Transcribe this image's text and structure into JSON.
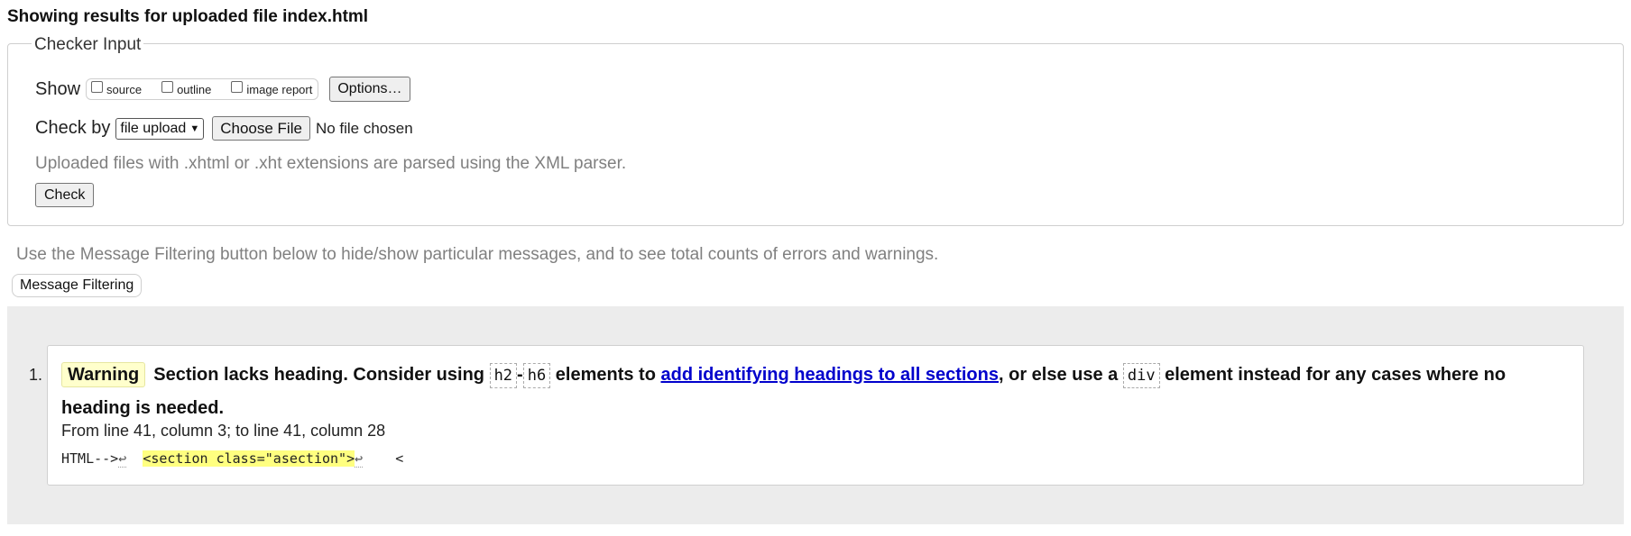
{
  "page": {
    "results_title": "Showing results for uploaded file index.html"
  },
  "checker_input": {
    "legend": "Checker Input",
    "show_label": "Show",
    "show_options": [
      {
        "label": "source",
        "checked": false
      },
      {
        "label": "outline",
        "checked": false
      },
      {
        "label": "image report",
        "checked": false
      }
    ],
    "options_button": "Options…",
    "check_by_label": "Check by",
    "check_by_selected": "file upload",
    "choose_file_button": "Choose File",
    "no_file_text": "No file chosen",
    "hint": "Uploaded files with .xhtml or .xht extensions are parsed using the XML parser.",
    "check_button": "Check"
  },
  "filtering": {
    "hint": "Use the Message Filtering button below to hide/show particular messages, and to see total counts of errors and warnings.",
    "button": "Message Filtering"
  },
  "messages": [
    {
      "number": "1.",
      "type": "Warning",
      "text_1": "Section lacks heading. Consider using",
      "code_1": "h2",
      "dash": "-",
      "code_2": "h6",
      "text_2": "elements to",
      "link": "add identifying headings to all sections",
      "text_3": ", or else use a",
      "code_3": "div",
      "text_4": "element instead for any cases where no heading is needed.",
      "location": "From line 41, column 3; to line 41, column 28",
      "extract_before": "HTML-->",
      "extract_lf": "↩",
      "extract_highlight": "<section class=\"asection\">",
      "extract_after": "<"
    }
  ],
  "colors": {
    "warning_badge_bg": "#ffffcc",
    "highlight": "#ffff80",
    "link": "#0000cc",
    "messages_bg": "#ececec",
    "hint_text": "#808080"
  }
}
